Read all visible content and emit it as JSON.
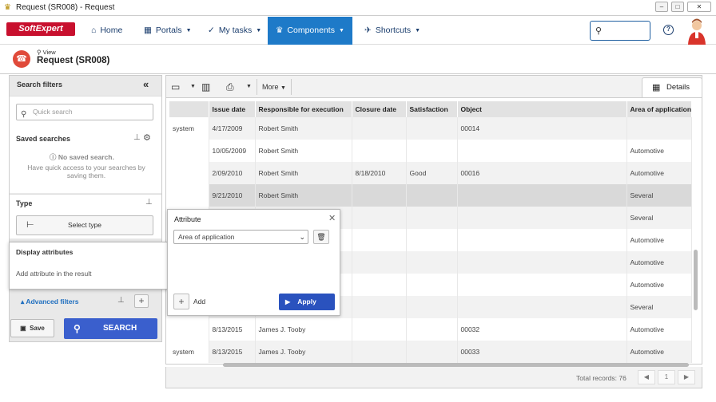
{
  "window": {
    "title": "Request (SR008) - Request",
    "buttons": [
      "–",
      "□",
      "✕"
    ]
  },
  "nav": {
    "logo": "SoftExpert",
    "items": [
      {
        "label": "Home",
        "icon": "home-icon",
        "glyph": "⌂"
      },
      {
        "label": "Portals",
        "icon": "grid-icon",
        "glyph": "▦"
      },
      {
        "label": "My tasks",
        "icon": "check-icon",
        "glyph": "✓"
      },
      {
        "label": "Components",
        "icon": "trophy-icon",
        "glyph": "♛"
      },
      {
        "label": "Shortcuts",
        "icon": "rocket-icon",
        "glyph": "✈"
      }
    ],
    "active": "Components",
    "help": "?"
  },
  "page": {
    "view_label": "View",
    "title": "Request (SR008)"
  },
  "left_panel": {
    "search_filters": "Search filters",
    "collapse": "«",
    "quick_search_placeholder": "Quick search",
    "saved_searches": "Saved searches",
    "no_saved_title": "No saved search.",
    "no_saved_text": "Have quick access to your searches by saving them.",
    "type_label": "Type",
    "select_type": "Select type",
    "advanced_filters": "Advanced filters",
    "save_btn": "Save",
    "search_btn": "SEARCH"
  },
  "display_attributes": {
    "title": "Display attributes",
    "text": "Add attribute in the result"
  },
  "attribute_popup": {
    "title": "Attribute",
    "selected": "Area of application",
    "add_label": "Add",
    "apply_label": "Apply"
  },
  "toolbar": {
    "more": "More",
    "details_tab": "Details"
  },
  "grid": {
    "columns": [
      "",
      "Issue date",
      "Responsible for execution",
      "Closure date",
      "Satisfaction",
      "Object",
      "Area of application"
    ],
    "rows": [
      [
        "system",
        "4/17/2009",
        "Robert Smith",
        "",
        "",
        "00014",
        ""
      ],
      [
        "",
        "10/05/2009",
        "Robert Smith",
        "",
        "",
        "",
        "Automotive"
      ],
      [
        "",
        "2/09/2010",
        "Robert Smith",
        "8/18/2010",
        "Good",
        "00016",
        "Automotive"
      ],
      [
        "",
        "9/21/2010",
        "Robert Smith",
        "",
        "",
        "",
        "Several"
      ],
      [
        "",
        "",
        "",
        "",
        "",
        "",
        "Several"
      ],
      [
        "",
        "",
        "",
        "",
        "",
        "",
        "Automotive"
      ],
      [
        "",
        "",
        "",
        "",
        "",
        "",
        "Automotive"
      ],
      [
        "",
        "",
        "",
        "",
        "",
        "",
        "Automotive"
      ],
      [
        "",
        "",
        "",
        "",
        "",
        "",
        "Several"
      ],
      [
        "",
        "8/13/2015",
        "James J. Tooby",
        "",
        "",
        "00032",
        "Automotive"
      ],
      [
        "system",
        "8/13/2015",
        "James J. Tooby",
        "",
        "",
        "00033",
        "Automotive"
      ]
    ],
    "selected_row": 3,
    "total_records": "Total records: 76"
  },
  "colors": {
    "accent": "#1e7ac8",
    "brand": "#c8102e",
    "apply": "#2a52be"
  }
}
